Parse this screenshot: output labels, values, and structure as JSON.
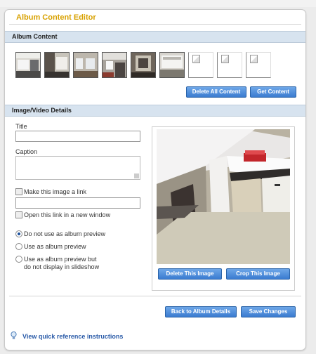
{
  "panel": {
    "title": "Album Content Editor"
  },
  "album_content": {
    "heading": "Album Content",
    "thumbnails": [
      {
        "kind": "image"
      },
      {
        "kind": "image"
      },
      {
        "kind": "image"
      },
      {
        "kind": "image"
      },
      {
        "kind": "image"
      },
      {
        "kind": "image"
      },
      {
        "kind": "placeholder"
      },
      {
        "kind": "placeholder"
      },
      {
        "kind": "placeholder"
      }
    ],
    "delete_all_label": "Delete All Content",
    "get_content_label": "Get Content"
  },
  "details": {
    "heading": "Image/Video Details",
    "title_label": "Title",
    "title_value": "",
    "caption_label": "Caption",
    "caption_value": "",
    "link_checkbox_label": "Make this image a link",
    "link_value": "",
    "new_window_label": "Open this link in a new window",
    "preview_options": [
      {
        "label": "Do not use as album preview",
        "selected": true
      },
      {
        "label": "Use as album preview",
        "selected": false
      },
      {
        "label": "Use as album preview but",
        "label2": "do not display in slideshow",
        "selected": false
      }
    ],
    "delete_image_label": "Delete This Image",
    "crop_image_label": "Crop This Image"
  },
  "footer": {
    "back_label": "Back to Album Details",
    "save_label": "Save Changes",
    "help_link": "View quick reference instructions"
  },
  "colors": {
    "accent_title": "#d8a100",
    "button_blue": "#3a7bd0",
    "section_bar": "#d7e3ef",
    "link": "#2a5ba8"
  }
}
